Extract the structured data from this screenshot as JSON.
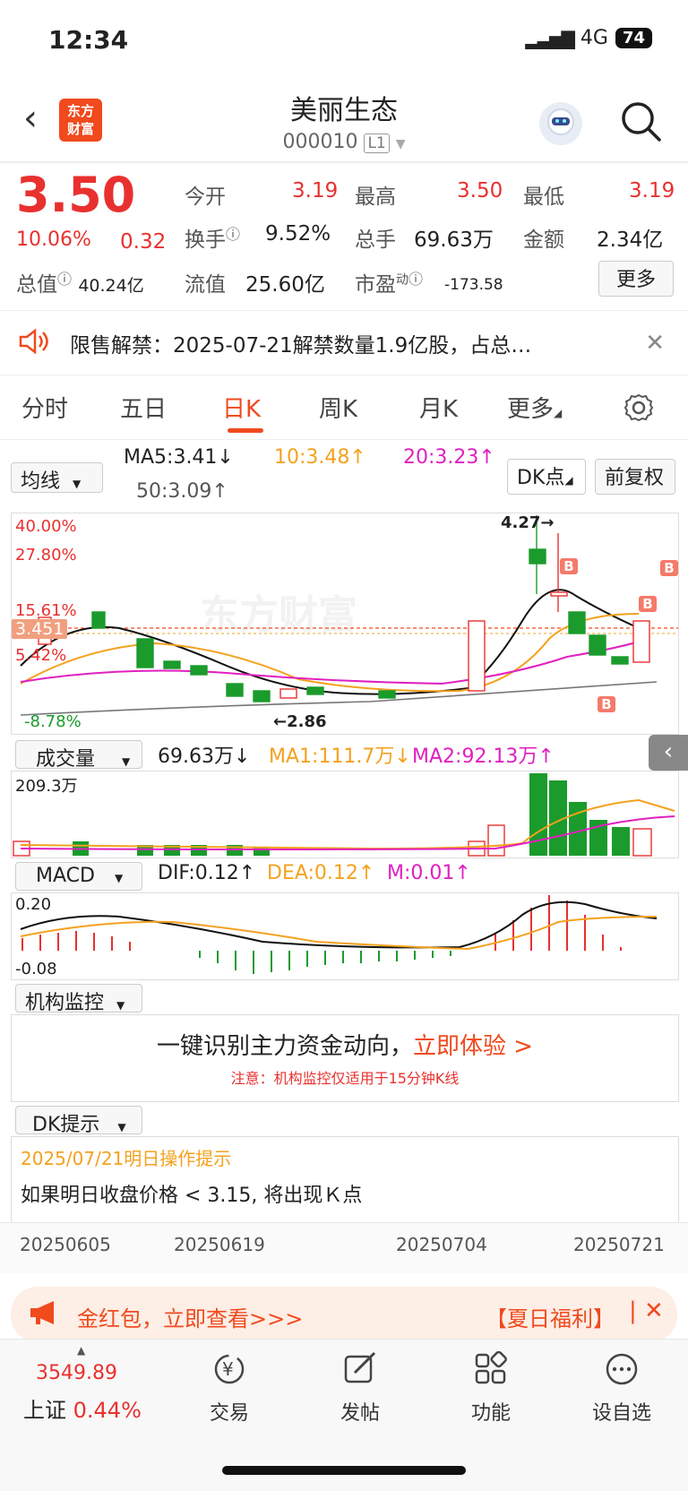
{
  "status_bar": {
    "time": "12:34",
    "network": "4G",
    "battery": "74"
  },
  "header": {
    "title": "美丽生态",
    "code": "000010",
    "level": "L1",
    "logo_line1": "东方",
    "logo_line2": "财富"
  },
  "quote": {
    "price": "3.50",
    "change_pct": "10.06%",
    "change": "0.32",
    "open_label": "今开",
    "open": "3.19",
    "high_label": "最高",
    "high": "3.50",
    "low_label": "最低",
    "low": "3.19",
    "turnover_label": "换手",
    "turnover": "9.52%",
    "volume_label": "总手",
    "volume": "69.63万",
    "amount_label": "金额",
    "amount": "2.34亿",
    "mktcap_label": "总值",
    "mktcap": "40.24亿",
    "float_label": "流值",
    "float": "25.60亿",
    "pe_label": "市盈",
    "pe_sup": "动",
    "pe": "-173.58",
    "more_label": "更多"
  },
  "notice": {
    "text": "限售解禁：2025-07-21解禁数量1.9亿股，占总…"
  },
  "tabs": [
    {
      "label": "分时"
    },
    {
      "label": "五日"
    },
    {
      "label": "日K"
    },
    {
      "label": "周K"
    },
    {
      "label": "月K"
    },
    {
      "label": "更多"
    }
  ],
  "kline": {
    "ma_select": "均线",
    "ma5": "MA5:3.41↓",
    "ma10": "10:3.48↑",
    "ma20": "20:3.23↑",
    "ma50": "50:3.09↑",
    "dk_button": "DK点",
    "adjust_button": "前复权",
    "pct_40": "40.00%",
    "pct_27": "27.80%",
    "pct_15": "15.61%",
    "pct_542": "5.42%",
    "pct_neg": "-8.78%",
    "current_price_tag": "3.451",
    "high_marker": "4.27→",
    "low_marker": "←2.86",
    "watermark": "东方财富",
    "b_mark": "B"
  },
  "volume": {
    "select": "成交量",
    "value": "69.63万↓",
    "ma1": "MA1:111.7万↓",
    "ma2": "MA2:92.13万↑",
    "max": "209.3万"
  },
  "macd": {
    "select": "MACD",
    "dif": "DIF:0.12↑",
    "dea": "DEA:0.12↑",
    "m": "M:0.01↑",
    "top": "0.20",
    "bottom": "-0.08"
  },
  "institution": {
    "select": "机构监控",
    "headline": "一键识别主力资金动向，",
    "cta": "立即体验 >",
    "note": "注意：机构监控仅适用于15分钟K线"
  },
  "dk_tip": {
    "select": "DK提示",
    "date_title": "2025/07/21明日操作提示",
    "text": "如果明日收盘价格 < 3.15, 将出现Ｋ点"
  },
  "dates": [
    "20250605",
    "20250619",
    "20250704",
    "20250721"
  ],
  "promo": {
    "text": "金红包，立即查看>>>",
    "tag": "【夏日福利】"
  },
  "bottom_nav": {
    "index_value": "3549.89",
    "index_name": "上证",
    "index_change": "0.44%",
    "items": [
      {
        "label": "交易",
        "icon": "yen-icon"
      },
      {
        "label": "发帖",
        "icon": "edit-icon"
      },
      {
        "label": "功能",
        "icon": "grid-icon"
      },
      {
        "label": "设自选",
        "icon": "more-icon"
      }
    ]
  },
  "colors": {
    "up": "#e8312f",
    "down": "#1a9b2c",
    "ma10": "#f4a11e",
    "ma20": "#e020c0",
    "accent": "#f04a1d"
  }
}
